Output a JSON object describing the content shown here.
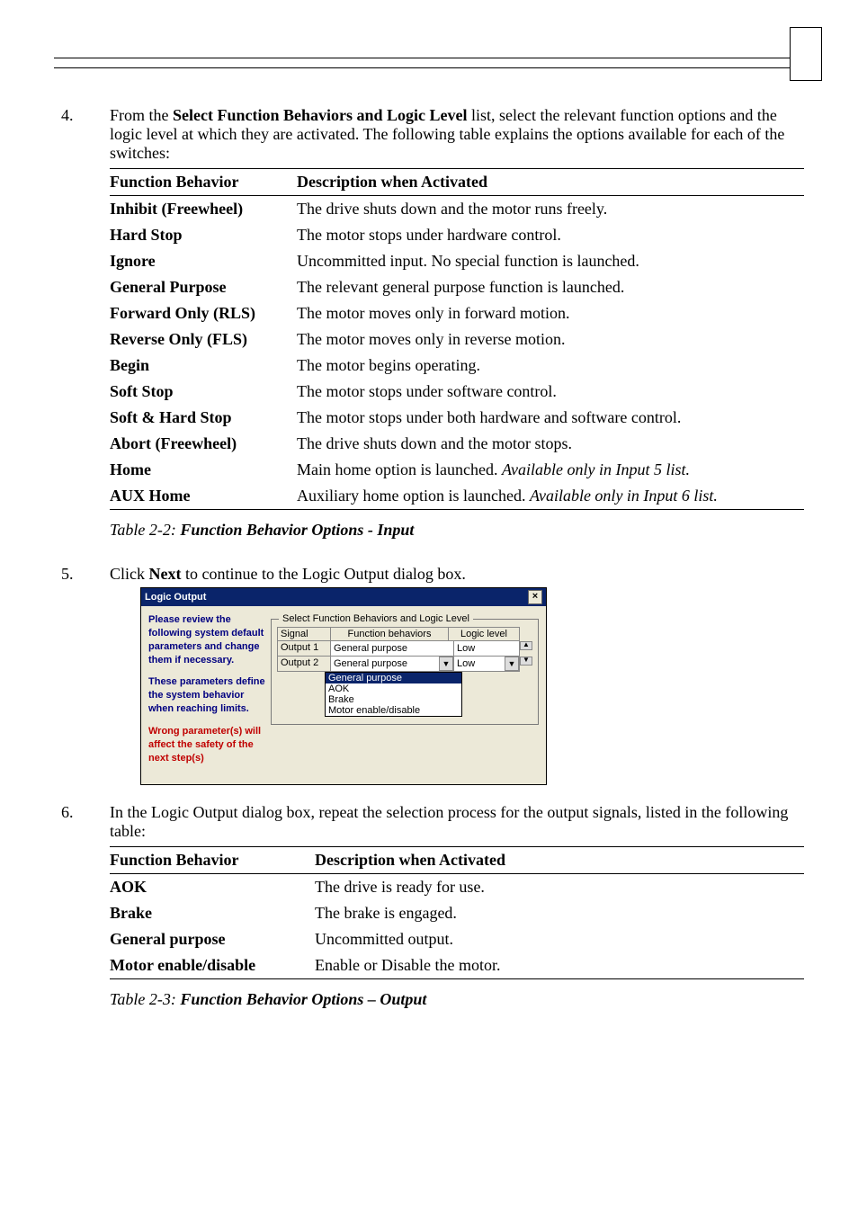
{
  "step4": {
    "num": "4.",
    "text_before": "From the ",
    "text_bold": "Select Function Behaviors and Logic Level",
    "text_after": " list, select the relevant function options and the logic level at which they are activated. The following table explains the options available for each of the switches:"
  },
  "table1": {
    "head_fb": "Function Behavior",
    "head_desc": "Description when Activated",
    "rows": [
      {
        "fb": "Inhibit (Freewheel)",
        "fb_bold": true,
        "desc": "The drive shuts down and the motor runs freely."
      },
      {
        "fb": "Hard Stop",
        "fb_bold": true,
        "desc": "The motor stops under hardware control."
      },
      {
        "fb": "Ignore",
        "fb_bold": true,
        "desc": "Uncommitted input. No special function is launched."
      },
      {
        "fb": "General Purpose",
        "fb_bold": true,
        "desc": "The relevant general purpose function is launched."
      },
      {
        "fb": "Forward Only (RLS)",
        "fb_bold": true,
        "desc": "The motor moves only in forward motion."
      },
      {
        "fb": "Reverse Only  (FLS)",
        "fb_bold": true,
        "desc": "The motor moves only in reverse motion."
      },
      {
        "fb": "Begin",
        "fb_bold": true,
        "desc": "The motor begins operating."
      },
      {
        "fb": "Soft Stop",
        "fb_bold": true,
        "desc": "The motor stops under software control."
      },
      {
        "fb": "Soft & Hard Stop",
        "fb_bold": true,
        "desc": "The motor stops under both hardware and software control."
      },
      {
        "fb": "Abort (Freewheel)",
        "fb_bold": true,
        "desc": "The drive shuts down and the motor stops."
      },
      {
        "fb": "Home",
        "fb_bold": true,
        "desc": "Main home option is launched. ",
        "desc_em": "Available only in Input 5 list."
      },
      {
        "fb": "AUX Home",
        "fb_bold": true,
        "desc": "Auxiliary home option is launched. ",
        "desc_em": "Available only in Input 6 list."
      }
    ]
  },
  "caption1": {
    "prefix": "Table 2-2: ",
    "bold": "Function Behavior Options - Input"
  },
  "step5": {
    "num": "5.",
    "text_before": "Click ",
    "text_bold": "Next",
    "text_after": " to continue to the Logic Output dialog box."
  },
  "dialog": {
    "title": "Logic Output",
    "close": "×",
    "left": {
      "p1": "Please review the following system default parameters and change them if necessary.",
      "p2": "These parameters define the system behavior when reaching limits.",
      "p3": "Wrong parameter(s) will affect the safety of the next step(s)"
    },
    "legend": "Select Function Behaviors and Logic Level",
    "head_signal": "Signal",
    "head_fb": "Function behaviors",
    "head_ll": "Logic level",
    "rows": [
      {
        "sig": "Output 1",
        "fb": "General purpose",
        "ll": "Low"
      },
      {
        "sig": "Output 2",
        "fb": "General purpose",
        "ll": "Low"
      }
    ],
    "dropdown": [
      "General purpose",
      "AOK",
      "Brake",
      "Motor enable/disable"
    ]
  },
  "step6": {
    "num": "6.",
    "text": "In the Logic Output dialog box, repeat the selection process for the output signals, listed in the following table:"
  },
  "table2": {
    "head_fb": "Function Behavior",
    "head_desc": "Description when Activated",
    "rows": [
      {
        "fb": "AOK",
        "desc": "The drive is ready for use."
      },
      {
        "fb": "Brake",
        "desc": "The brake is engaged."
      },
      {
        "fb": "General purpose",
        "desc": "Uncommitted output."
      },
      {
        "fb": "Motor enable/disable",
        "desc": "Enable or Disable the motor."
      }
    ]
  },
  "caption2": {
    "prefix": "Table 2-3: ",
    "bold": "Function Behavior Options – Output"
  }
}
